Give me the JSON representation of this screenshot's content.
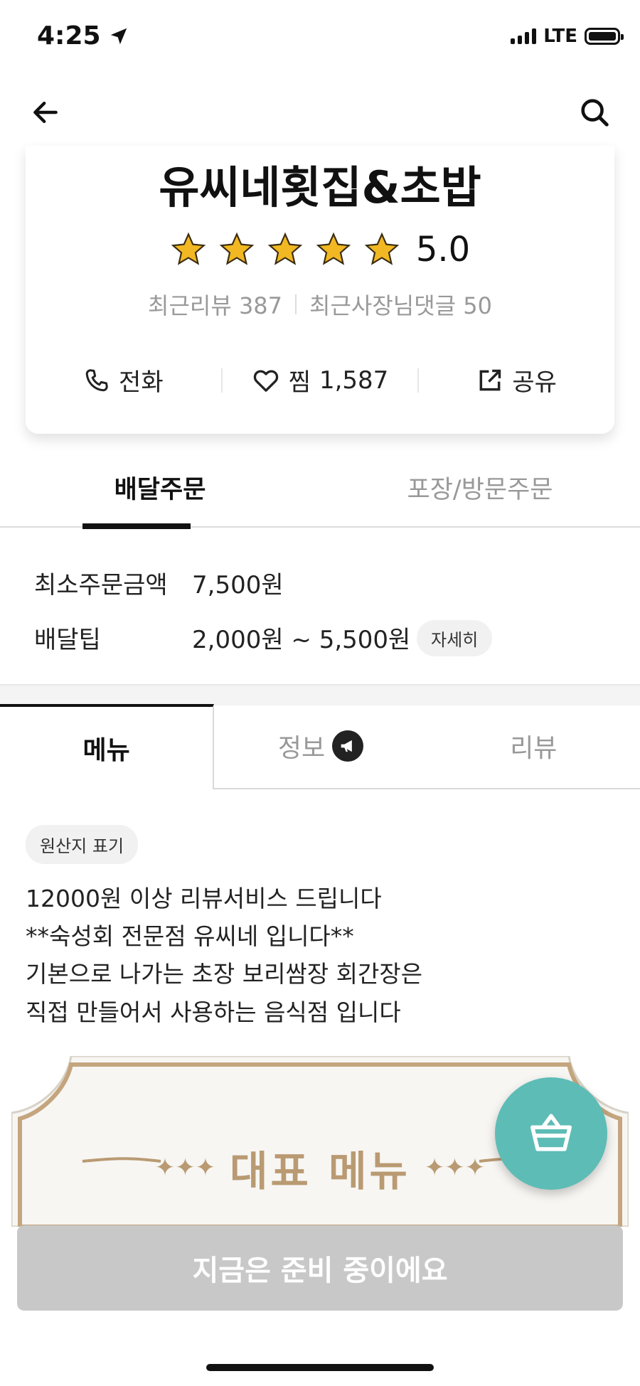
{
  "status_bar": {
    "time": "4:25",
    "network": "LTE"
  },
  "nav": {
    "back_icon": "arrow-left-icon",
    "search_icon": "search-icon"
  },
  "store": {
    "name": "유씨네횟집&초밥",
    "rating": "5.0",
    "stars": 5,
    "recent_reviews_label": "최근리뷰",
    "recent_reviews_count": "387",
    "owner_replies_label": "최근사장님댓글",
    "owner_replies_count": "50"
  },
  "actions": {
    "call_label": "전화",
    "favorite_label": "찜",
    "favorite_count": "1,587",
    "share_label": "공유"
  },
  "order_tabs": [
    {
      "label": "배달주문",
      "active": true
    },
    {
      "label": "포장/방문주문",
      "active": false
    }
  ],
  "order_info": {
    "min_order_label": "최소주문금액",
    "min_order_value": "7,500원",
    "delivery_tip_label": "배달팁",
    "delivery_tip_value": "2,000원 ~ 5,500원",
    "detail_label": "자세히"
  },
  "content_tabs": [
    {
      "label": "메뉴",
      "active": true
    },
    {
      "label": "정보",
      "active": false,
      "icon": "megaphone-icon"
    },
    {
      "label": "리뷰",
      "active": false
    }
  ],
  "origin_label": "원산지 표기",
  "notice_lines": [
    "12000원 이상 리뷰서비스 드립니다",
    "**숙성회 전문점 유씨네 입니다**",
    "기본으로 나가는 초장 보리쌈장 회간장은",
    "직접 만들어서 사용하는 음식점 입니다"
  ],
  "banner": {
    "title": "대표 메뉴"
  },
  "cart_icon": "basket-icon",
  "bottom_button": {
    "label": "지금은 준비 중이에요"
  },
  "colors": {
    "accent_teal": "#5dbcb6",
    "banner_gold": "#b99a72",
    "star_gold": "#f2b823",
    "disabled_gray": "#c8c8c8"
  }
}
